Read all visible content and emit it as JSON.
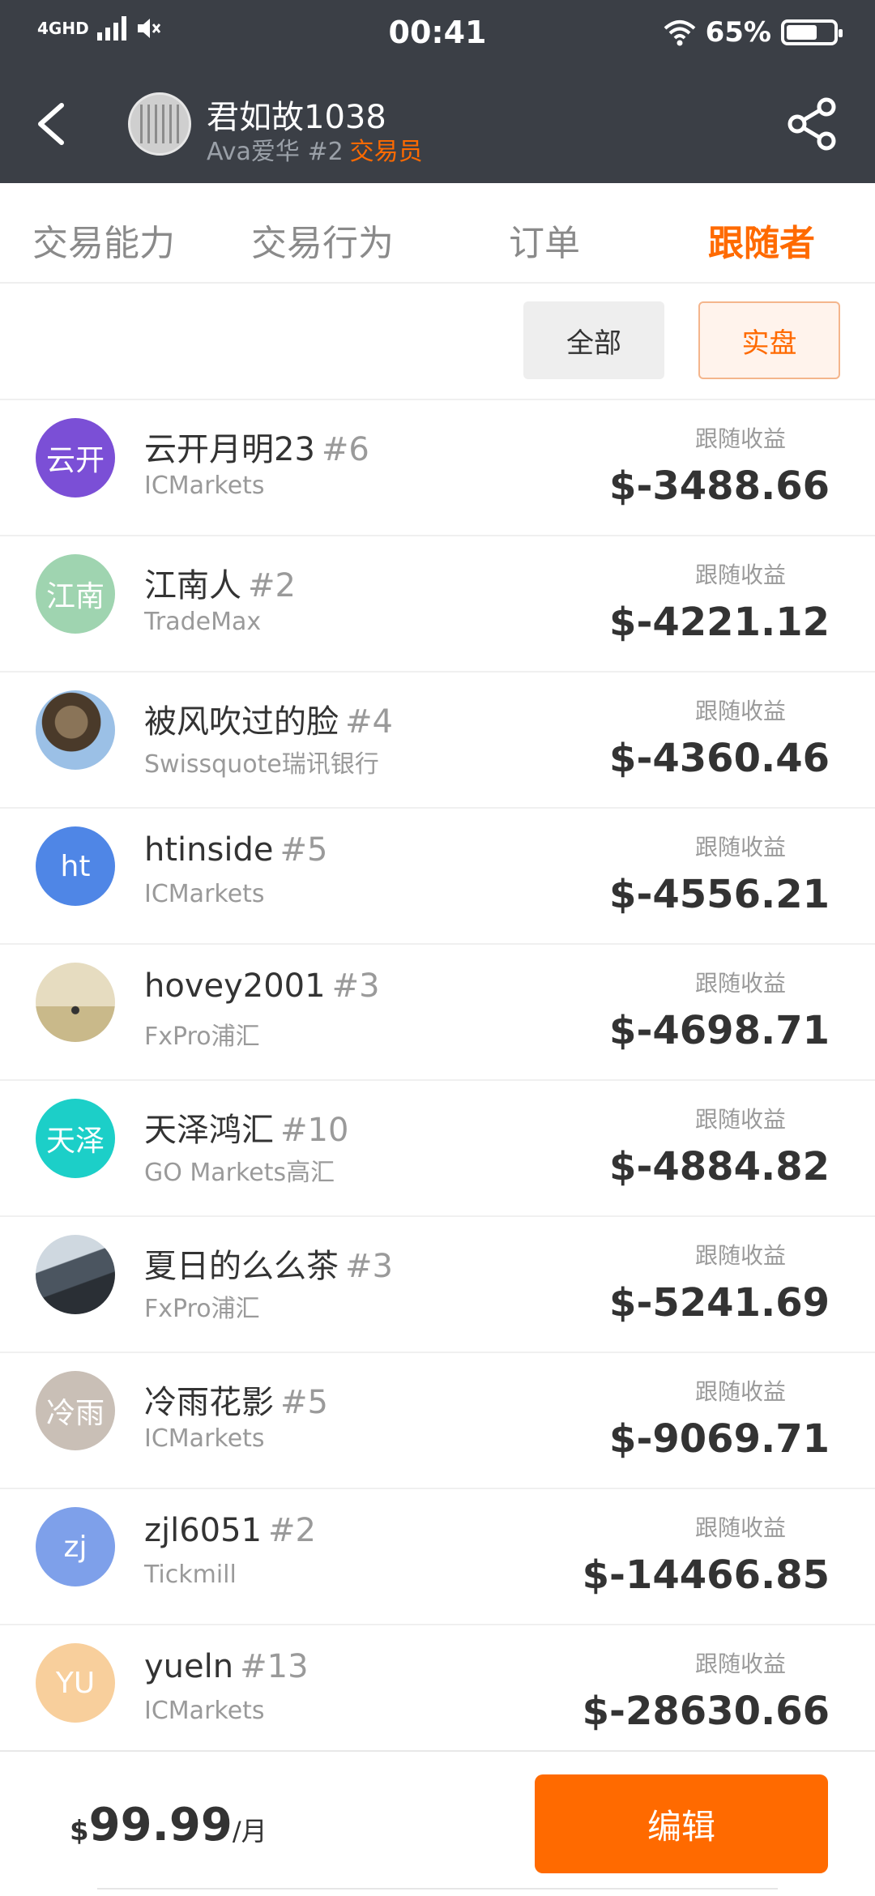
{
  "status_bar": {
    "network": "4GHD",
    "time": "00:41",
    "battery": "65%",
    "battery_level": 0.65
  },
  "header": {
    "name": "君如故1038",
    "sub_name": "Ava爱华 #2",
    "role": "交易员",
    "back_icon": "chevron-left-icon",
    "share_icon": "share-icon"
  },
  "tabs": [
    {
      "label": "交易能力"
    },
    {
      "label": "交易行为"
    },
    {
      "label": "订单"
    },
    {
      "label": "跟随者",
      "active": true
    }
  ],
  "filters": {
    "all": "全部",
    "real": "实盘",
    "selected": "实盘"
  },
  "followers": [
    {
      "avatar_text": "云开",
      "avatar_color": "#7b4fd6",
      "name": "云开月明23",
      "rank": "#6",
      "broker": "ICMarkets",
      "profit_label": "跟随收益",
      "profit": "$-3488.66"
    },
    {
      "avatar_text": "江南",
      "avatar_color": "#9fd4b0",
      "name": "江南人",
      "rank": "#2",
      "broker": "TradeMax",
      "profit_label": "跟随收益",
      "profit": "$-4221.12"
    },
    {
      "avatar_text": "",
      "avatar_color": "#6b5a46",
      "name": "被风吹过的脸",
      "rank": "#4",
      "broker": "Swissquote瑞讯银行",
      "profit_label": "跟随收益",
      "profit": "$-4360.46"
    },
    {
      "avatar_text": "ht",
      "avatar_color": "#4f86e6",
      "name": "htinside",
      "rank": "#5",
      "broker": "ICMarkets",
      "profit_label": "跟随收益",
      "profit": "$-4556.21"
    },
    {
      "avatar_text": "",
      "avatar_color": "#d9cfae",
      "name": "hovey2001",
      "rank": "#3",
      "broker": "FxPro浦汇",
      "profit_label": "跟随收益",
      "profit": "$-4698.71"
    },
    {
      "avatar_text": "天泽",
      "avatar_color": "#1ccfc8",
      "name": "天泽鸿汇",
      "rank": "#10",
      "broker": "GO Markets高汇",
      "profit_label": "跟随收益",
      "profit": "$-4884.82"
    },
    {
      "avatar_text": "",
      "avatar_color": "#5d6670",
      "name": "夏日的么么茶",
      "rank": "#3",
      "broker": "FxPro浦汇",
      "profit_label": "跟随收益",
      "profit": "$-5241.69"
    },
    {
      "avatar_text": "冷雨",
      "avatar_color": "#c9bfb6",
      "name": "冷雨花影",
      "rank": "#5",
      "broker": "ICMarkets",
      "profit_label": "跟随收益",
      "profit": "$-9069.71"
    },
    {
      "avatar_text": "zj",
      "avatar_color": "#7ea0ea",
      "name": "zjl6051",
      "rank": "#2",
      "broker": "Tickmill",
      "profit_label": "跟随收益",
      "profit": "$-14466.85"
    },
    {
      "avatar_text": "YU",
      "avatar_color": "#f8cf9c",
      "name": "yueln",
      "rank": "#13",
      "broker": "ICMarkets",
      "profit_label": "跟随收益",
      "profit": "$-28630.66"
    }
  ],
  "footer": {
    "currency": "$",
    "price": "99.99",
    "unit": "/月",
    "edit_label": "编辑"
  },
  "colors": {
    "accent": "#ff6a00",
    "header_bg": "#3b3f46"
  }
}
